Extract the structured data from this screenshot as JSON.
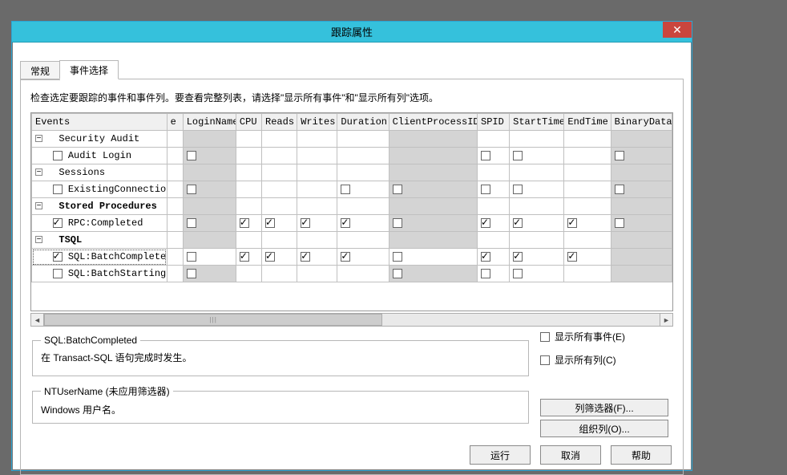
{
  "window": {
    "title": "跟踪属性",
    "close": "✕"
  },
  "tabs": {
    "general": "常规",
    "events": "事件选择"
  },
  "instruction": "检查选定要跟踪的事件和事件列。要查看完整列表，请选择\"显示所有事件\"和\"显示所有列\"选项。",
  "columns": {
    "events": "Events",
    "e": "e",
    "login": "LoginName",
    "cpu": "CPU",
    "reads": "Reads",
    "writes": "Writes",
    "duration": "Duration",
    "cpid": "ClientProcessID",
    "spid": "SPID",
    "start": "StartTime",
    "end": "EndTime",
    "bin": "BinaryData"
  },
  "rows": {
    "secAudit": "Security Audit",
    "auditLogin": "Audit Login",
    "sessions": "Sessions",
    "existConn": "ExistingConnection",
    "storedProc": "Stored Procedures",
    "rpcComp": "RPC:Completed",
    "tsql": "TSQL",
    "batchComp": "SQL:BatchCompleted",
    "batchStart": "SQL:BatchStarting"
  },
  "detail1": {
    "legend": "SQL:BatchCompleted",
    "text": "在 Transact-SQL 语句完成时发生。"
  },
  "detail2": {
    "legend": "NTUserName (未应用筛选器)",
    "text": "Windows 用户名。"
  },
  "opts": {
    "showAllEvents": "显示所有事件(E)",
    "showAllCols": "显示所有列(C)",
    "colFilter": "列筛选器(F)...",
    "organize": "组织列(O)..."
  },
  "footer": {
    "run": "运行",
    "cancel": "取消",
    "help": "帮助"
  },
  "scrollbar": {
    "grip": "|||"
  }
}
